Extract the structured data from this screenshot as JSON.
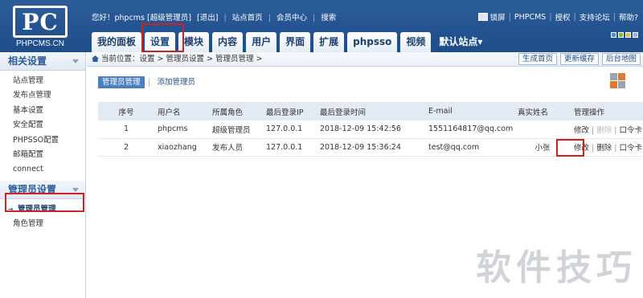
{
  "logo": {
    "mark": "PC",
    "name": "PHPCMS.CN"
  },
  "user_bar": {
    "greeting": "您好！phpcms [超级管理员]",
    "logout": "[退出]",
    "site_home": "站点首页",
    "member_center": "会员中心",
    "search": "搜索"
  },
  "right_bar": {
    "lock": "锁屏",
    "brand": "PHPCMS",
    "license": "授权",
    "forum": "支持论坛",
    "help": "帮助?"
  },
  "nav": {
    "tabs": [
      "我的面板",
      "设置",
      "模块",
      "内容",
      "用户",
      "界面",
      "扩展",
      "phpsso",
      "视频"
    ],
    "active_index": 1,
    "default_site": "默认站点▾"
  },
  "swatch_colors": [
    "#4a90d9",
    "#7cc04a",
    "#e0c040",
    "#9ab4d4"
  ],
  "sidebar": {
    "section1_title": "相关设置",
    "section1_items": [
      "站点管理",
      "发布点管理",
      "基本设置",
      "安全配置",
      "PHPSSO配置",
      "邮箱配置",
      "connect"
    ],
    "section2_title": "管理员设置",
    "section2_items": [
      "管理员管理",
      "角色管理"
    ],
    "active_item": "管理员管理"
  },
  "breadcrumb": "当前位置：设置 > 管理员设置 > 管理员管理 >",
  "toolbar_buttons": [
    "生成首页",
    "更新缓存",
    "后台地图"
  ],
  "subtabs": [
    "管理员管理",
    "添加管理员"
  ],
  "table": {
    "headers": [
      "序号",
      "用户名",
      "所属角色",
      "最后登录IP",
      "最后登录时间",
      "E-mail",
      "真实姓名",
      "管理操作"
    ],
    "rows": [
      {
        "id": "1",
        "username": "phpcms",
        "role": "超级管理员",
        "ip": "127.0.0.1",
        "time": "2018-12-09 15:42:56",
        "email": "1551164817@qq.com",
        "realname": "",
        "edit": "修改",
        "delete": "删除",
        "token": "口令卡"
      },
      {
        "id": "2",
        "username": "xiaozhang",
        "role": "发布人员",
        "ip": "127.0.0.1",
        "time": "2018-12-09 15:36:24",
        "email": "test@qq.com",
        "realname": "小张",
        "edit": "修改",
        "delete": "删除",
        "token": "口令卡"
      }
    ]
  },
  "watermark": "软件技巧",
  "highlight_color": "#d02020"
}
